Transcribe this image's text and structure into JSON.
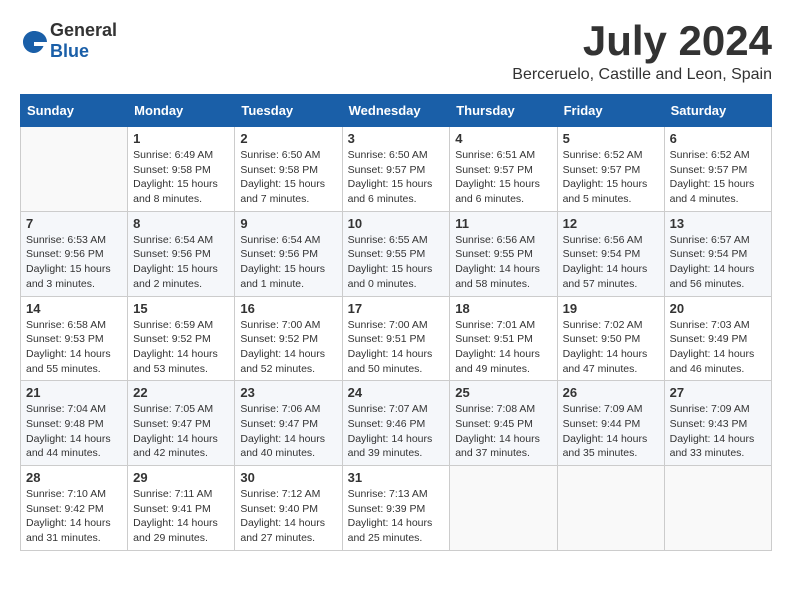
{
  "header": {
    "logo_general": "General",
    "logo_blue": "Blue",
    "month_title": "July 2024",
    "location": "Berceruelo, Castille and Leon, Spain"
  },
  "days_of_week": [
    "Sunday",
    "Monday",
    "Tuesday",
    "Wednesday",
    "Thursday",
    "Friday",
    "Saturday"
  ],
  "weeks": [
    [
      {
        "day": "",
        "info": ""
      },
      {
        "day": "1",
        "info": "Sunrise: 6:49 AM\nSunset: 9:58 PM\nDaylight: 15 hours\nand 8 minutes."
      },
      {
        "day": "2",
        "info": "Sunrise: 6:50 AM\nSunset: 9:58 PM\nDaylight: 15 hours\nand 7 minutes."
      },
      {
        "day": "3",
        "info": "Sunrise: 6:50 AM\nSunset: 9:57 PM\nDaylight: 15 hours\nand 6 minutes."
      },
      {
        "day": "4",
        "info": "Sunrise: 6:51 AM\nSunset: 9:57 PM\nDaylight: 15 hours\nand 6 minutes."
      },
      {
        "day": "5",
        "info": "Sunrise: 6:52 AM\nSunset: 9:57 PM\nDaylight: 15 hours\nand 5 minutes."
      },
      {
        "day": "6",
        "info": "Sunrise: 6:52 AM\nSunset: 9:57 PM\nDaylight: 15 hours\nand 4 minutes."
      }
    ],
    [
      {
        "day": "7",
        "info": "Sunrise: 6:53 AM\nSunset: 9:56 PM\nDaylight: 15 hours\nand 3 minutes."
      },
      {
        "day": "8",
        "info": "Sunrise: 6:54 AM\nSunset: 9:56 PM\nDaylight: 15 hours\nand 2 minutes."
      },
      {
        "day": "9",
        "info": "Sunrise: 6:54 AM\nSunset: 9:56 PM\nDaylight: 15 hours\nand 1 minute."
      },
      {
        "day": "10",
        "info": "Sunrise: 6:55 AM\nSunset: 9:55 PM\nDaylight: 15 hours\nand 0 minutes."
      },
      {
        "day": "11",
        "info": "Sunrise: 6:56 AM\nSunset: 9:55 PM\nDaylight: 14 hours\nand 58 minutes."
      },
      {
        "day": "12",
        "info": "Sunrise: 6:56 AM\nSunset: 9:54 PM\nDaylight: 14 hours\nand 57 minutes."
      },
      {
        "day": "13",
        "info": "Sunrise: 6:57 AM\nSunset: 9:54 PM\nDaylight: 14 hours\nand 56 minutes."
      }
    ],
    [
      {
        "day": "14",
        "info": "Sunrise: 6:58 AM\nSunset: 9:53 PM\nDaylight: 14 hours\nand 55 minutes."
      },
      {
        "day": "15",
        "info": "Sunrise: 6:59 AM\nSunset: 9:52 PM\nDaylight: 14 hours\nand 53 minutes."
      },
      {
        "day": "16",
        "info": "Sunrise: 7:00 AM\nSunset: 9:52 PM\nDaylight: 14 hours\nand 52 minutes."
      },
      {
        "day": "17",
        "info": "Sunrise: 7:00 AM\nSunset: 9:51 PM\nDaylight: 14 hours\nand 50 minutes."
      },
      {
        "day": "18",
        "info": "Sunrise: 7:01 AM\nSunset: 9:51 PM\nDaylight: 14 hours\nand 49 minutes."
      },
      {
        "day": "19",
        "info": "Sunrise: 7:02 AM\nSunset: 9:50 PM\nDaylight: 14 hours\nand 47 minutes."
      },
      {
        "day": "20",
        "info": "Sunrise: 7:03 AM\nSunset: 9:49 PM\nDaylight: 14 hours\nand 46 minutes."
      }
    ],
    [
      {
        "day": "21",
        "info": "Sunrise: 7:04 AM\nSunset: 9:48 PM\nDaylight: 14 hours\nand 44 minutes."
      },
      {
        "day": "22",
        "info": "Sunrise: 7:05 AM\nSunset: 9:47 PM\nDaylight: 14 hours\nand 42 minutes."
      },
      {
        "day": "23",
        "info": "Sunrise: 7:06 AM\nSunset: 9:47 PM\nDaylight: 14 hours\nand 40 minutes."
      },
      {
        "day": "24",
        "info": "Sunrise: 7:07 AM\nSunset: 9:46 PM\nDaylight: 14 hours\nand 39 minutes."
      },
      {
        "day": "25",
        "info": "Sunrise: 7:08 AM\nSunset: 9:45 PM\nDaylight: 14 hours\nand 37 minutes."
      },
      {
        "day": "26",
        "info": "Sunrise: 7:09 AM\nSunset: 9:44 PM\nDaylight: 14 hours\nand 35 minutes."
      },
      {
        "day": "27",
        "info": "Sunrise: 7:09 AM\nSunset: 9:43 PM\nDaylight: 14 hours\nand 33 minutes."
      }
    ],
    [
      {
        "day": "28",
        "info": "Sunrise: 7:10 AM\nSunset: 9:42 PM\nDaylight: 14 hours\nand 31 minutes."
      },
      {
        "day": "29",
        "info": "Sunrise: 7:11 AM\nSunset: 9:41 PM\nDaylight: 14 hours\nand 29 minutes."
      },
      {
        "day": "30",
        "info": "Sunrise: 7:12 AM\nSunset: 9:40 PM\nDaylight: 14 hours\nand 27 minutes."
      },
      {
        "day": "31",
        "info": "Sunrise: 7:13 AM\nSunset: 9:39 PM\nDaylight: 14 hours\nand 25 minutes."
      },
      {
        "day": "",
        "info": ""
      },
      {
        "day": "",
        "info": ""
      },
      {
        "day": "",
        "info": ""
      }
    ]
  ]
}
